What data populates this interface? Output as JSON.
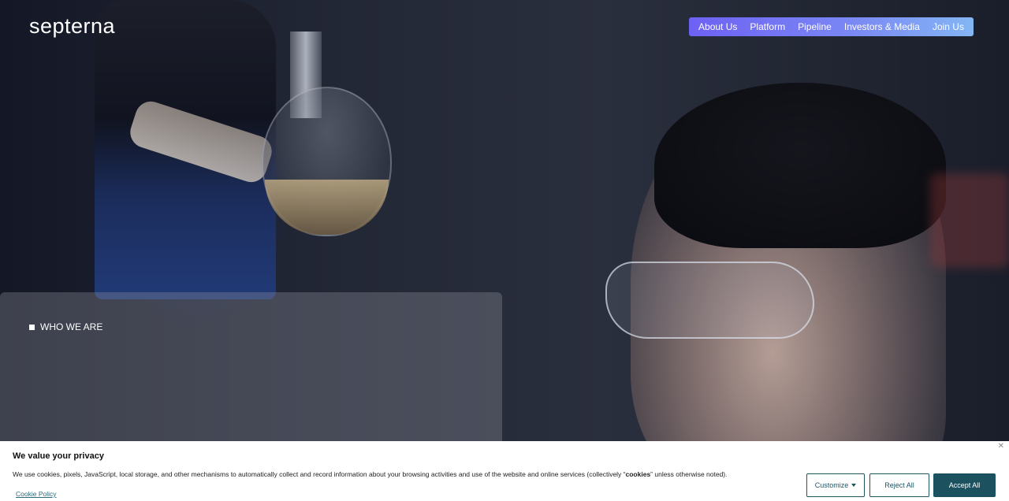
{
  "brand": {
    "logo_text": "septerna"
  },
  "nav": {
    "items": [
      {
        "label": "About Us"
      },
      {
        "label": "Platform"
      },
      {
        "label": "Pipeline"
      },
      {
        "label": "Investors & Media"
      },
      {
        "label": "Join Us"
      }
    ]
  },
  "hero": {
    "section_label": "WHO WE ARE",
    "section_icon": "square-icon"
  },
  "cookie_banner": {
    "title": "We value your privacy",
    "text_before": "We use cookies, pixels, JavaScript, local storage, and other mechanisms to automatically collect and record information about your browsing activities and use of the website and online services (collectively “",
    "text_bold": "cookies",
    "text_after": "” unless otherwise noted).",
    "policy_link": "Cookie Policy",
    "close_icon": "close-icon",
    "customize_label": "Customize",
    "reject_label": "Reject All",
    "accept_label": "Accept All"
  },
  "colors": {
    "nav_gradient_start": "#6d61f3",
    "nav_gradient_end": "#84b6f4",
    "cookie_accent": "#1c5160"
  }
}
